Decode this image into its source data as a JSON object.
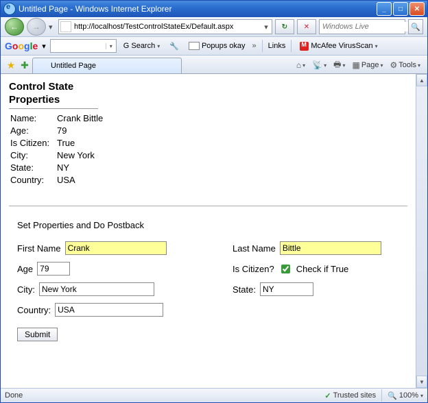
{
  "window": {
    "title": "Untitled Page - Windows Internet Explorer"
  },
  "nav": {
    "url": "http://localhost/TestControlStateEx/Default.aspx"
  },
  "search": {
    "placeholder": "Windows Live"
  },
  "google": {
    "logo": "Google",
    "search_label": "Search",
    "popups_label": "Popups okay",
    "links_label": "Links",
    "av_label": "McAfee VirusScan"
  },
  "tabs": {
    "active": "Untitled Page"
  },
  "toolbar": {
    "home": "",
    "feeds": "",
    "print": "",
    "page_label": "Page",
    "tools_label": "Tools"
  },
  "page": {
    "heading1": "Control State",
    "heading2": "Properties",
    "props": {
      "name_label": "Name:",
      "name_value": "Crank Bittle",
      "age_label": "Age:",
      "age_value": "79",
      "citizen_label": "Is Citizen:",
      "citizen_value": "True",
      "city_label": "City:",
      "city_value": "New York",
      "state_label": "State:",
      "state_value": "NY",
      "country_label": "Country:",
      "country_value": "USA"
    },
    "form_title": "Set Properties and Do Postback",
    "form": {
      "firstname_label": "First Name",
      "firstname_value": "Crank",
      "lastname_label": "Last Name",
      "lastname_value": "Bittle",
      "age_label": "Age",
      "age_value": "79",
      "citizen_label": "Is Citizen?",
      "citizen_check_label": "Check if True",
      "city_label": "City:",
      "city_value": "New York",
      "state_label": "State:",
      "state_value": "NY",
      "country_label": "Country:",
      "country_value": "USA",
      "submit_label": "Submit"
    }
  },
  "status": {
    "done": "Done",
    "trusted": "Trusted sites",
    "zoom": "100%"
  }
}
